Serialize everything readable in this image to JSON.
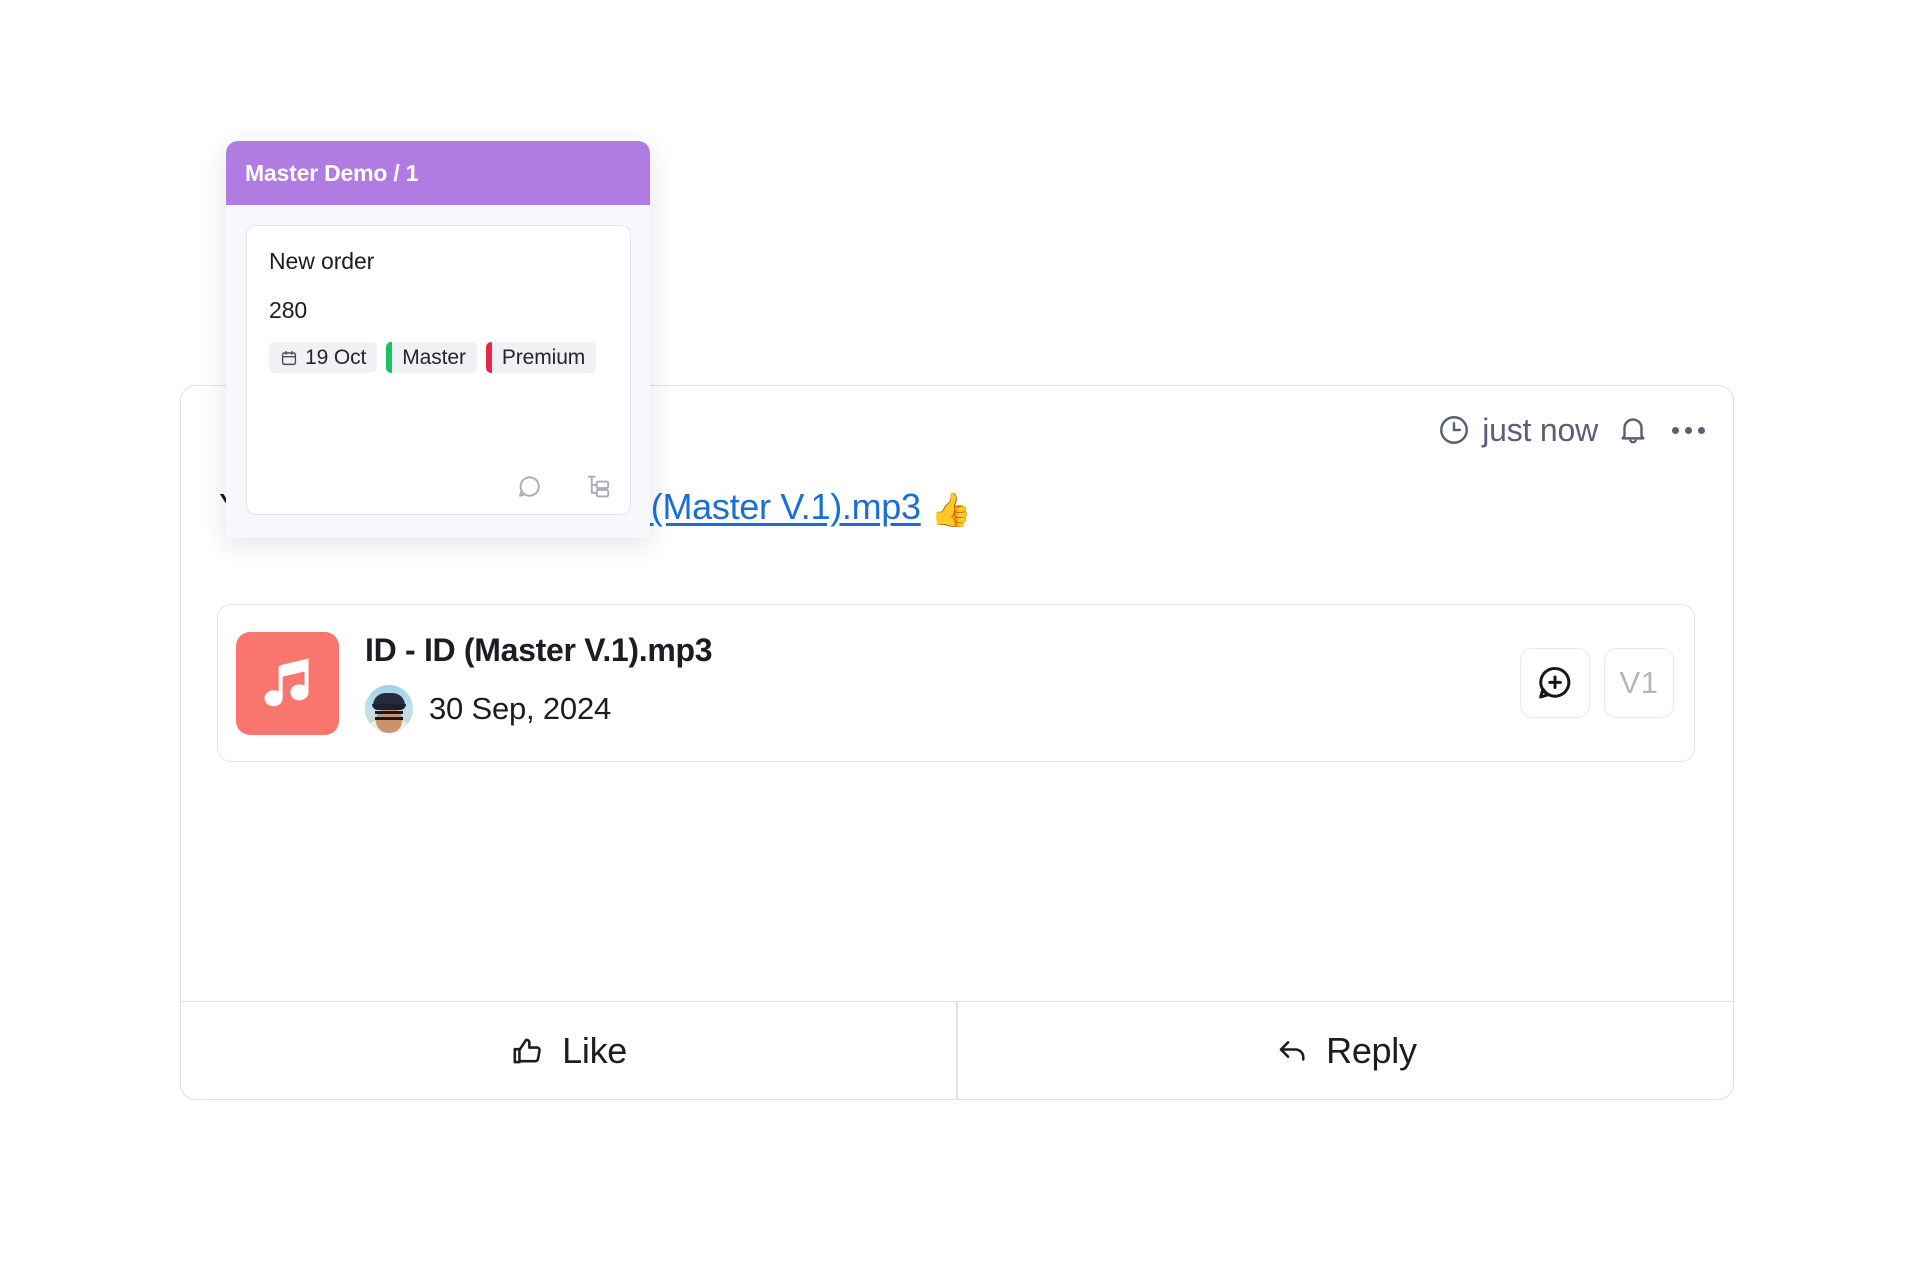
{
  "popup": {
    "title": "Master Demo / 1",
    "task": {
      "name": "New order",
      "number": "280",
      "chips": [
        {
          "label": "19 Oct",
          "icon": "calendar-icon",
          "mark": null
        },
        {
          "label": "Master",
          "icon": null,
          "mark": "#18c364"
        },
        {
          "label": "Premium",
          "icon": null,
          "mark": "#e8274b"
        }
      ],
      "icons": [
        "comment-icon",
        "subtask-tree-icon"
      ]
    },
    "header_color": "#b07ce2"
  },
  "comment": {
    "timestamp": "just now",
    "icons": {
      "clock": "clock-icon",
      "bell": "bell-icon",
      "more": "more-options-icon"
    },
    "text_before_link": "Your demo is ready.",
    "link_text": "ID - ID (Master V.1).mp3",
    "link_color": "#1a6fd4",
    "emoji": "👍",
    "attachment": {
      "file_name": "ID - ID (Master V.1).mp3",
      "date": "30 Sep, 2024",
      "thumb_color": "#f8766d",
      "thumb_icon": "music-note-icon",
      "add_comment_icon": "add-comment-icon",
      "version_label": "V1"
    },
    "footer": {
      "like_label": "Like",
      "like_icon": "thumbs-up-icon",
      "reply_label": "Reply",
      "reply_icon": "reply-arrow-icon"
    }
  }
}
